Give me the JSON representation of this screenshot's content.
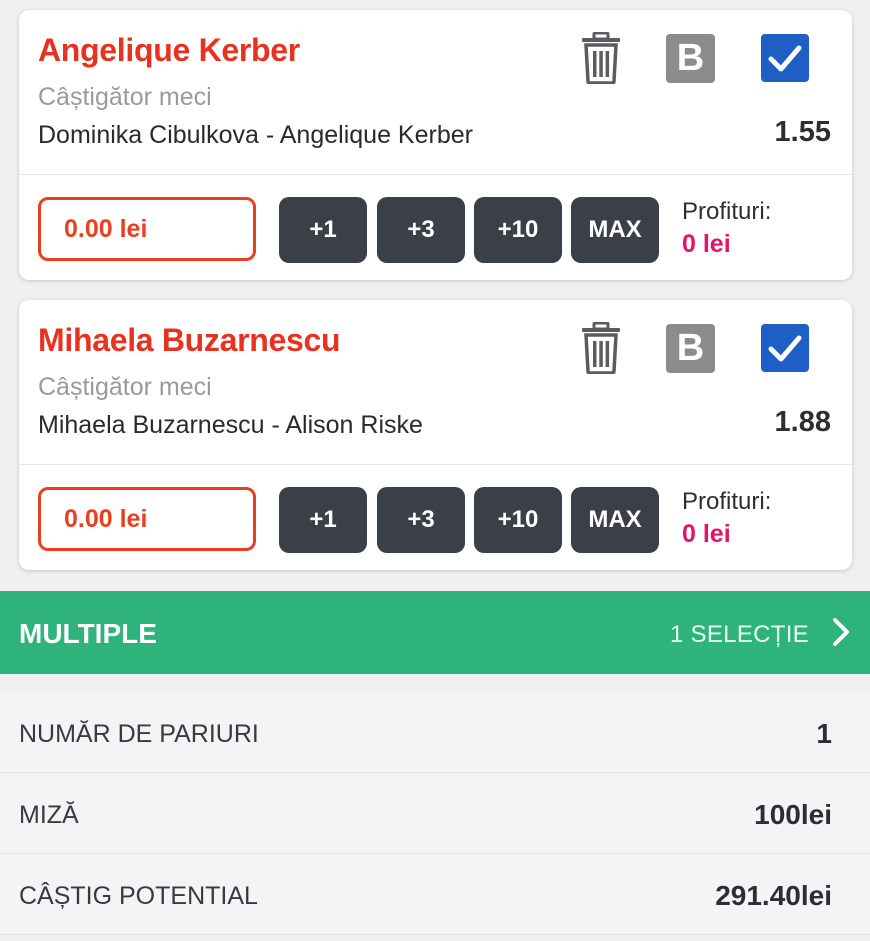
{
  "bets": [
    {
      "selection": "Angelique Kerber",
      "market": "Câștigător meci",
      "event": "Dominika Cibulkova - Angelique Kerber",
      "odds": "1.55",
      "stake": "0.00 lei",
      "quick_stakes": [
        "+1",
        "+3",
        "+10",
        "MAX"
      ],
      "banker_label": "B",
      "profit_label": "Profituri:",
      "profit_value": "0 lei",
      "checked": true
    },
    {
      "selection": "Mihaela Buzarnescu",
      "market": "Câștigător meci",
      "event": "Mihaela Buzarnescu - Alison Riske",
      "odds": "1.88",
      "stake": "0.00 lei",
      "quick_stakes": [
        "+1",
        "+3",
        "+10",
        "MAX"
      ],
      "banker_label": "B",
      "profit_label": "Profituri:",
      "profit_value": "0 lei",
      "checked": true
    }
  ],
  "multiple": {
    "title": "MULTIPLE",
    "selections": "1 SELECȚIE"
  },
  "summary": [
    {
      "label": "NUMĂR DE PARIURI",
      "value": "1"
    },
    {
      "label": "MIZĂ",
      "value": "100lei"
    },
    {
      "label": "CÂȘTIG POTENTIAL",
      "value": "291.40lei"
    }
  ],
  "icons": {
    "delete": "trash-icon",
    "banker": "banker-icon",
    "select": "checkbox-checked-icon",
    "expand": "chevron-right-icon"
  },
  "colors": {
    "selection_red": "#e8311e",
    "profit_pink": "#e8106a",
    "multiple_green": "#2eb37a",
    "checkbox_blue": "#1f5ec4",
    "button_dark": "#3b3f47"
  }
}
